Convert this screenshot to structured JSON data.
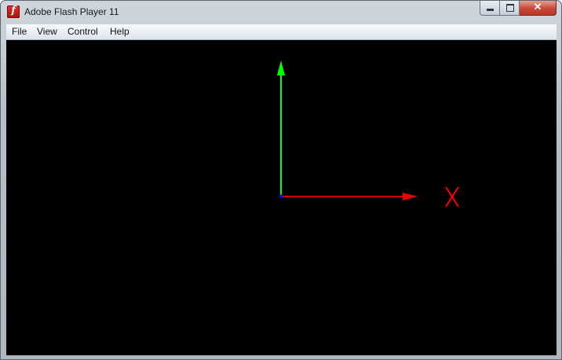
{
  "window": {
    "title": "Adobe Flash Player 11",
    "app_icon_glyph": "f",
    "controls": {
      "minimize": "minimize-icon",
      "maximize": "maximize-icon",
      "close_glyph": "✕"
    }
  },
  "menu": {
    "items": [
      {
        "label": "File"
      },
      {
        "label": "View"
      },
      {
        "label": "Control"
      },
      {
        "label": "Help"
      }
    ]
  },
  "stage": {
    "background": "#000000",
    "axes": {
      "y_axis_color": "#00ff00",
      "x_axis_color": "#cc0000",
      "origin_color": "#0000ff",
      "marker_color": "#ff0000",
      "marker_icon": "x-cross-marker"
    }
  }
}
